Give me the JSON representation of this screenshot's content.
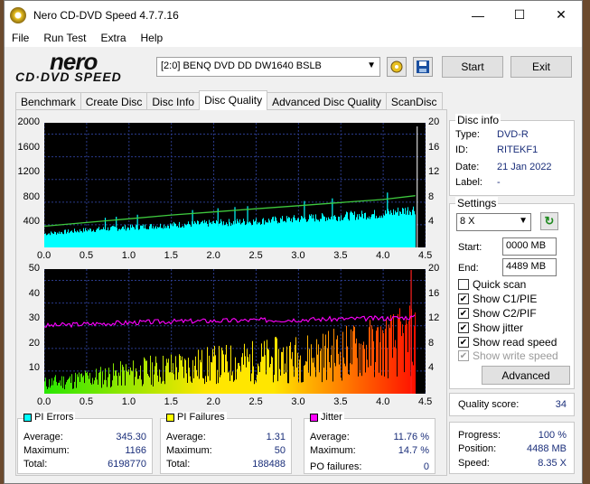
{
  "window": {
    "title": "Nero CD-DVD Speed 4.7.7.16"
  },
  "titlebar_buttons": {
    "minimize": "—",
    "maximize": "☐",
    "close": "✕"
  },
  "menu": [
    "File",
    "Run Test",
    "Extra",
    "Help"
  ],
  "logo": {
    "line1": "nero",
    "line2": "CD·DVD SPEED"
  },
  "drive": {
    "selected": "[2:0]  BENQ DVD DD DW1640 BSLB"
  },
  "toolbar": {
    "start": "Start",
    "exit": "Exit"
  },
  "tabs": [
    "Benchmark",
    "Create Disc",
    "Disc Info",
    "Disc Quality",
    "Advanced Disc Quality",
    "ScanDisc"
  ],
  "active_tab": "Disc Quality",
  "chart_data": [
    {
      "type": "area",
      "name": "read",
      "x_ticks": [
        "0.0",
        "0.5",
        "1.0",
        "1.5",
        "2.0",
        "2.5",
        "3.0",
        "3.5",
        "4.0",
        "4.5"
      ],
      "y_left_ticks": [
        "2000",
        "1600",
        "1200",
        "800",
        "400"
      ],
      "y_right_ticks": [
        "20",
        "16",
        "12",
        "8",
        "4"
      ],
      "xlim": [
        0,
        4.5
      ],
      "ylim_left": [
        0,
        2000
      ],
      "ylim_right": [
        0,
        20
      ],
      "series": [
        {
          "name": "PI Errors",
          "color": "#00ffff",
          "x": [
            0,
            0.5,
            1,
            1.5,
            2,
            2.5,
            3,
            3.5,
            4,
            4.38
          ],
          "y": [
            220,
            280,
            320,
            360,
            390,
            420,
            460,
            500,
            540,
            620
          ]
        },
        {
          "name": "Read speed",
          "color": "#3ec93e",
          "x": [
            0,
            0.5,
            1,
            1.5,
            2,
            2.5,
            3,
            3.5,
            4,
            4.38
          ],
          "y": [
            3.4,
            4.0,
            4.6,
            5.2,
            5.7,
            6.2,
            6.7,
            7.2,
            7.7,
            8.3
          ]
        }
      ],
      "grid": true
    },
    {
      "type": "bar",
      "name": "quality",
      "x_ticks": [
        "0.0",
        "0.5",
        "1.0",
        "1.5",
        "2.0",
        "2.5",
        "3.0",
        "3.5",
        "4.0",
        "4.5"
      ],
      "y_left_ticks": [
        "50",
        "40",
        "30",
        "20",
        "10"
      ],
      "y_right_ticks": [
        "20",
        "16",
        "12",
        "8",
        "4"
      ],
      "xlim": [
        0,
        4.5
      ],
      "ylim_left": [
        0,
        50
      ],
      "ylim_right": [
        0,
        20
      ],
      "series": [
        {
          "name": "PI Failures",
          "x": [
            0,
            0.5,
            1,
            1.5,
            2,
            2.5,
            3,
            3.5,
            4,
            4.38
          ],
          "y": [
            6,
            9,
            12,
            15,
            17,
            19,
            21,
            24,
            28,
            32
          ]
        },
        {
          "name": "Jitter",
          "color": "#ff00ff",
          "x": [
            0,
            0.5,
            1,
            1.5,
            2,
            2.5,
            3,
            3.5,
            4,
            4.38
          ],
          "y": [
            10.9,
            11.2,
            11.4,
            11.6,
            11.7,
            11.8,
            11.9,
            12.0,
            12.1,
            12.3
          ]
        }
      ],
      "grid": true
    }
  ],
  "stats": {
    "pi_errors": {
      "label": "PI Errors",
      "color": "#00ffff",
      "average_label": "Average:",
      "average": "345.30",
      "maximum_label": "Maximum:",
      "maximum": "1166",
      "total_label": "Total:",
      "total": "6198770"
    },
    "pi_failures": {
      "label": "PI Failures",
      "color": "#ffff00",
      "average_label": "Average:",
      "average": "1.31",
      "maximum_label": "Maximum:",
      "maximum": "50",
      "total_label": "Total:",
      "total": "188488"
    },
    "jitter": {
      "label": "Jitter",
      "color": "#ff00ff",
      "average_label": "Average:",
      "average": "11.76 %",
      "maximum_label": "Maximum:",
      "maximum": "14.7 %",
      "po_label": "PO failures:",
      "po": "0"
    }
  },
  "disc_info": {
    "title": "Disc info",
    "type_label": "Type:",
    "type": "DVD-R",
    "id_label": "ID:",
    "id": "RITEKF1",
    "date_label": "Date:",
    "date": "21 Jan 2022",
    "label_label": "Label:",
    "label": "-"
  },
  "settings": {
    "title": "Settings",
    "speed": "8 X",
    "start_label": "Start:",
    "start": "0000 MB",
    "end_label": "End:",
    "end": "4489 MB",
    "quick_scan": "Quick scan",
    "show_c1": "Show C1/PIE",
    "show_c2": "Show C2/PIF",
    "show_jitter": "Show jitter",
    "show_read": "Show read speed",
    "show_write": "Show write speed",
    "advanced": "Advanced"
  },
  "quality": {
    "label": "Quality score:",
    "value": "34"
  },
  "progress": {
    "progress_label": "Progress:",
    "progress": "100 %",
    "position_label": "Position:",
    "position": "4488 MB",
    "speed_label": "Speed:",
    "speed": "8.35 X"
  }
}
